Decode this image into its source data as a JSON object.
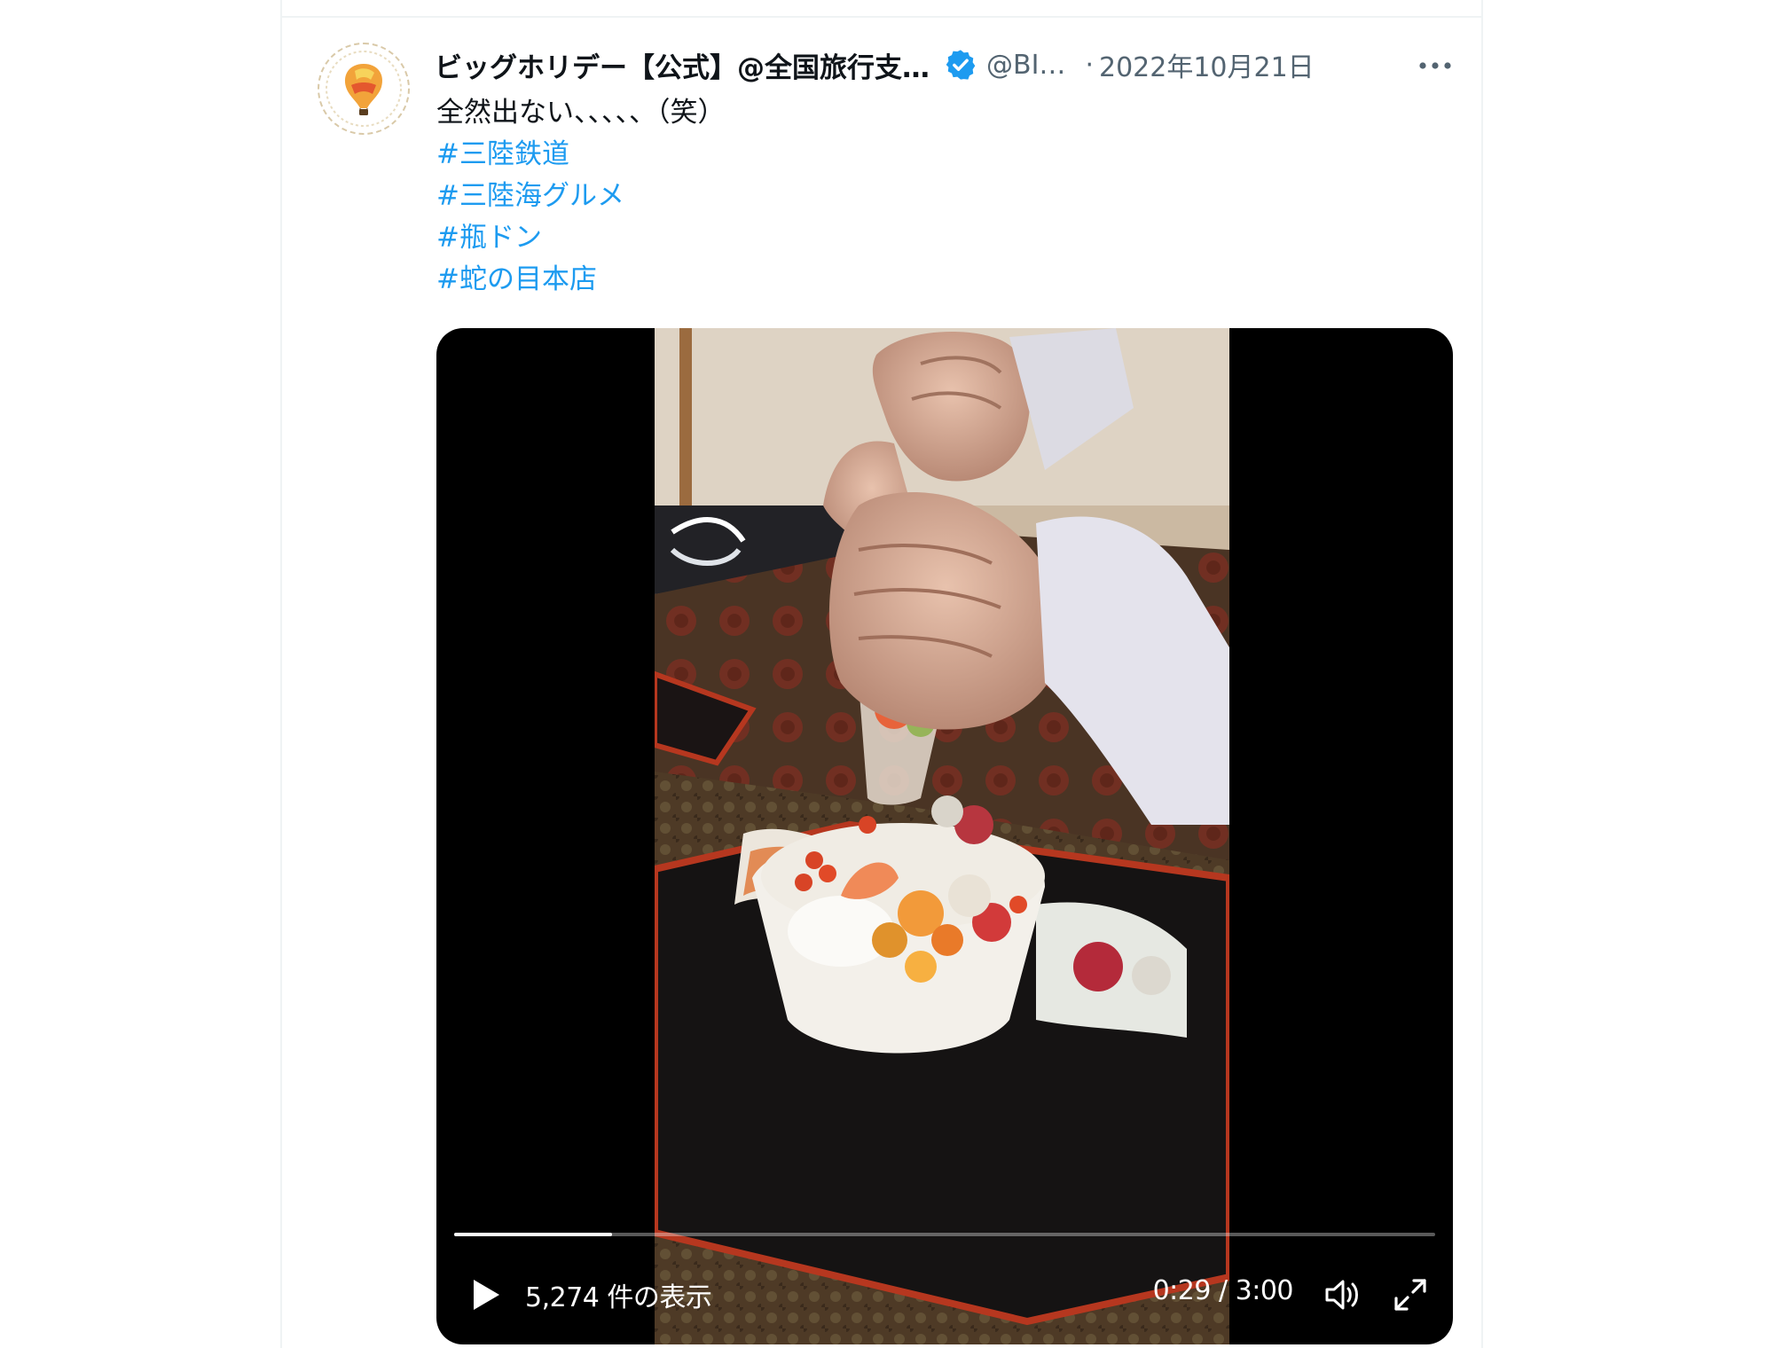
{
  "tweet": {
    "display_name": "ビッグホリデー【公式】@全国旅行支…",
    "handle": "@BI…",
    "separator": "·",
    "timestamp": "2022年10月21日",
    "text": "全然出ない、、、、、（笑）",
    "hashtags": [
      "#三陸鉄道",
      "#三陸海グルメ",
      "#瓶ドン",
      "#蛇の目本店"
    ],
    "verified_color": "#1d9bf0",
    "link_color": "#1d9bf0"
  },
  "video": {
    "view_count": "5,274 件の表示",
    "time": "0:29 / 3:00",
    "progress": 0.161,
    "icons": [
      "play-icon",
      "volume-icon",
      "fullscreen-icon"
    ]
  },
  "icons": {
    "more": "more-icon",
    "verified": "verified-badge-icon",
    "avatar": "balloon-logo"
  }
}
